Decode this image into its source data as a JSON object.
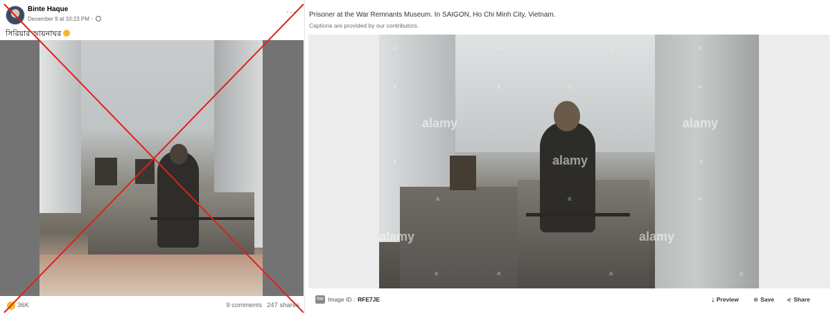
{
  "facebook_post": {
    "author": "Binte Haque",
    "timestamp": "December 9 at 10:23 PM · ",
    "caption": "সিরিয়ার আয়নাঘর",
    "reaction_count": "36K",
    "comments": "9 comments",
    "shares": "247 shares",
    "crossed_out": true,
    "cross_color": "#e0201a"
  },
  "stock_photo": {
    "title": "Prisoner at the War Remnants Museum. In SAIGON, Ho Chi Minh City, Vietnam.",
    "subtitle": "Captions are provided by our contributors.",
    "watermark": "alamy",
    "watermark_small": "a",
    "image_id_badge": "RM",
    "image_id_label": "Image ID :",
    "image_id_value": "RFE7JE",
    "actions": {
      "preview": "Preview",
      "save": "Save",
      "share": "Share"
    }
  }
}
